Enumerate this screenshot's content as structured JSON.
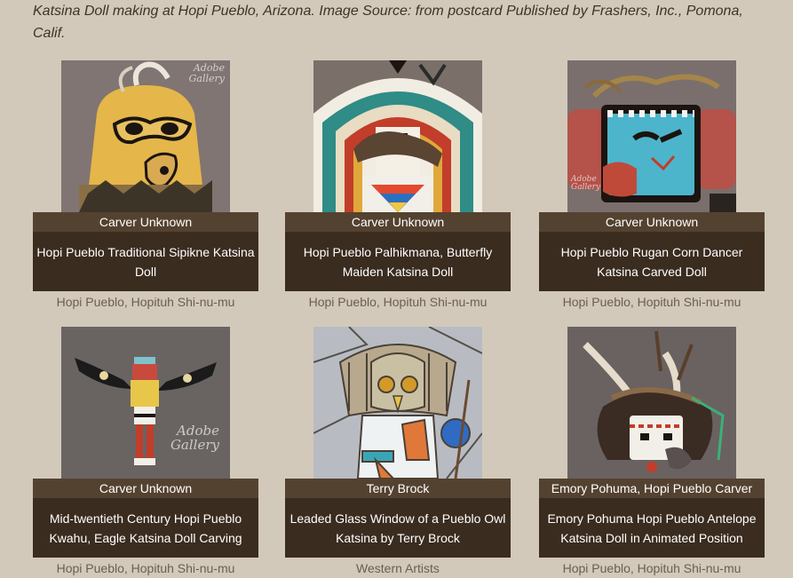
{
  "caption": "Katsina Doll making at Hopi Pueblo, Arizona. Image Source: from postcard Published by Frashers, Inc., Pomona, Calif.",
  "cards": [
    {
      "artist": "Carver Unknown",
      "title": "Hopi Pueblo Traditional Sipikne Katsina Doll",
      "category": "Hopi Pueblo, Hopituh Shi-nu-mu",
      "watermark": "Adobe Gallery"
    },
    {
      "artist": "Carver Unknown",
      "title": "Hopi Pueblo Palhikmana, Butterfly Maiden Katsina Doll",
      "category": "Hopi Pueblo, Hopituh Shi-nu-mu"
    },
    {
      "artist": "Carver Unknown",
      "title": "Hopi Pueblo Rugan Corn Dancer Katsina Carved Doll",
      "category": "Hopi Pueblo, Hopituh Shi-nu-mu",
      "watermark": "Adobe Gallery"
    },
    {
      "artist": "Carver Unknown",
      "title": "Mid-twentieth Century Hopi Pueblo Kwahu, Eagle Katsina Doll Carving",
      "category": "Hopi Pueblo, Hopituh Shi-nu-mu",
      "watermark": "Adobe Gallery"
    },
    {
      "artist": "Terry Brock",
      "title": "Leaded Glass Window of a Pueblo Owl Katsina by Terry Brock",
      "category": "Western Artists"
    },
    {
      "artist": "Emory Pohuma, Hopi Pueblo Carver",
      "title": "Emory Pohuma Hopi Pueblo Antelope Katsina Doll in Animated Position",
      "category": "Hopi Pueblo, Hopituh Shi-nu-mu"
    }
  ],
  "colors": {
    "background": "#d2c9bb",
    "artist_bar": "#544230",
    "title_box": "#3a2c1f",
    "category_text": "#6b5e50"
  }
}
